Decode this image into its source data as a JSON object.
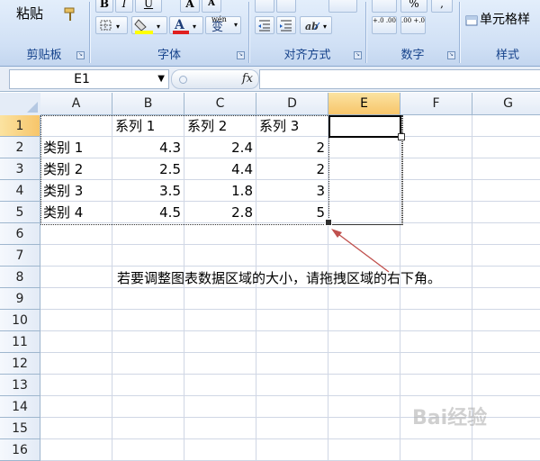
{
  "ribbon": {
    "clipboard": {
      "paste_label": "粘贴",
      "group_label": "剪贴板"
    },
    "font": {
      "group_label": "字体",
      "bold": "B",
      "italic": "I",
      "underline": "U",
      "grow": "A",
      "shrink": "A",
      "font_color": "A",
      "phonetic": "变",
      "phonetic_top": "wén"
    },
    "alignment": {
      "group_label": "对齐方式"
    },
    "number": {
      "group_label": "数字",
      "percent": "%",
      "comma": ",",
      "inc_decimal": "+.0 .00",
      "dec_decimal": ".00 +.0"
    },
    "styles": {
      "format_cells": "单元格样",
      "group_label": "样式"
    }
  },
  "formula_bar": {
    "name_box": "E1",
    "fx": "fx",
    "formula": ""
  },
  "sheet": {
    "columns": [
      "A",
      "B",
      "C",
      "D",
      "E",
      "F",
      "G"
    ],
    "rows": [
      "1",
      "2",
      "3",
      "4",
      "5",
      "6",
      "7",
      "8",
      "9",
      "10",
      "11",
      "12",
      "13",
      "14",
      "15",
      "16"
    ],
    "active_cell": "E1",
    "cells": {
      "B1": "系列 1",
      "C1": "系列 2",
      "D1": "系列 3",
      "A2": "类别 1",
      "B2": "4.3",
      "C2": "2.4",
      "D2": "2",
      "A3": "类别 2",
      "B3": "2.5",
      "C3": "4.4",
      "D3": "2",
      "A4": "类别 3",
      "B4": "3.5",
      "C4": "1.8",
      "D4": "3",
      "A5": "类别 4",
      "B5": "4.5",
      "C5": "2.8",
      "D5": "5"
    }
  },
  "annotation": {
    "text": "若要调整图表数据区域的大小，请拖拽区域的右下角。",
    "arrow_color": "#c0504d"
  },
  "watermark": "Bai经验",
  "colors": {
    "ribbon_label": "#15428b",
    "active_header": "#f7c56a",
    "grid_line": "#d0d7e5"
  }
}
